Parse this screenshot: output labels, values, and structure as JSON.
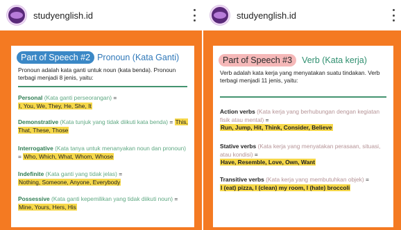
{
  "posts": [
    {
      "account": "studyenglish.id",
      "title_pill": "Part of Speech #2",
      "title_rest": "Pronoun (Kata Ganti)",
      "intro": "Pronoun adalah kata ganti untuk noun (kata benda). Pronoun terbagi menjadi 8 jenis, yaitu:",
      "items": [
        {
          "term": "Personal",
          "gloss": "(Kata ganti perseorangan)",
          "eq": " = ",
          "examples": "I, You, We, They, He, She, It"
        },
        {
          "term": "Demonstrative",
          "gloss": "(Kata tunjuk yang tidak diikuti kata benda)",
          "eq": " = ",
          "examples": "This, That, These, Those"
        },
        {
          "term": "Interrogative",
          "gloss": "(Kata tanya untuk menanyakan noun dan pronoun)",
          "eq": " = ",
          "examples": "Who, Which, What, Whom, Whose"
        },
        {
          "term": "Indefinite",
          "gloss": "(Kata ganti yang tidak jelas)",
          "eq": " = ",
          "examples": "Nothing, Someone, Anyone, Everybody"
        },
        {
          "term": "Possessive",
          "gloss": "(Kata ganti kepemilikan yang tidak diikuti noun)",
          "eq": " = ",
          "examples": "Mine, Yours, Hers, His"
        }
      ]
    },
    {
      "account": "studyenglish.id",
      "title_pill": "Part of Speech #3",
      "title_rest": "Verb (Kata kerja)",
      "intro": "Verb adalah kata kerja yang menyatakan suatu tindakan. Verb terbagi menjadi 11 jenis, yaitu:",
      "items": [
        {
          "term": "Action verbs",
          "gloss": "(Kata kerja yang berhubungan dengan kegiatan fisik atau mental)",
          "eq": " =",
          "examples": "Run, Jump, Hit, Think, Consider, Believe"
        },
        {
          "term": "Stative verbs",
          "gloss": "(Kata kerja yang menyatakan perasaan, situasi, atau kondisi)",
          "eq": " =",
          "examples": "Have, Resemble, Love, Own, Want"
        },
        {
          "term": "Transitive verbs",
          "gloss": "(Kata kerja yang membutuhkan objek)",
          "eq": " =",
          "examples": "I (eat) pizza, I (clean) my room, I (hate) broccoli"
        }
      ]
    }
  ],
  "colors": {
    "slide_background": "#f47a22",
    "highlight": "#f6d84a",
    "pill_blue": "#3b88c6",
    "pill_pink": "#f5b8b8",
    "divider_green": "#43936f"
  },
  "icons": {
    "avatar": "account-avatar-icon",
    "menu": "more-vertical-icon"
  }
}
